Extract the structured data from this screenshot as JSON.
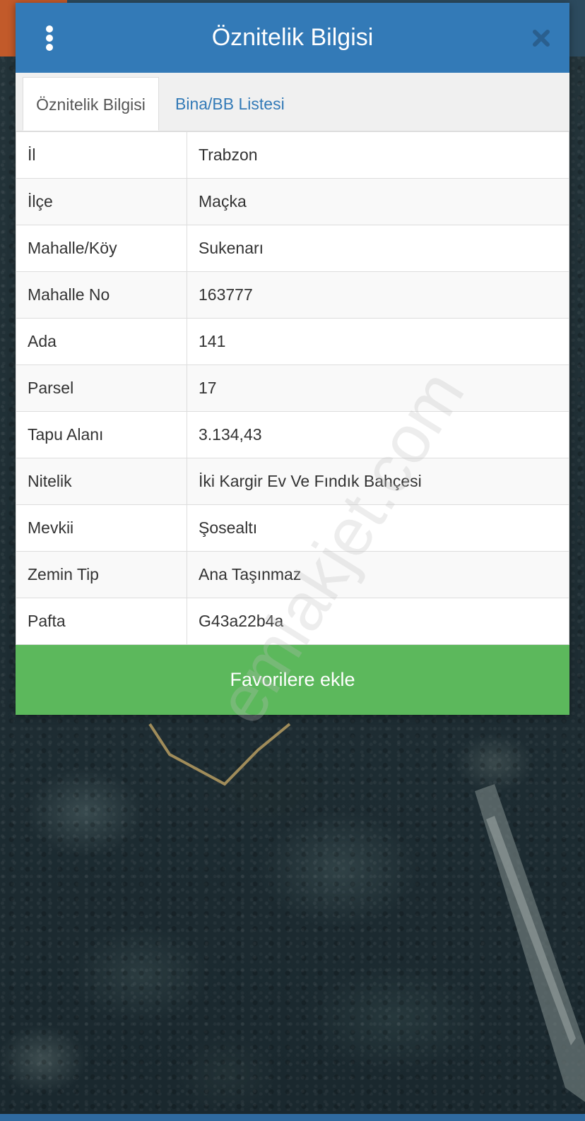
{
  "header": {
    "title": "Öznitelik Bilgisi"
  },
  "tabs": [
    {
      "label": "Öznitelik Bilgisi",
      "active": true
    },
    {
      "label": "Bina/BB Listesi",
      "active": false
    }
  ],
  "attributes": [
    {
      "key": "İl",
      "value": "Trabzon"
    },
    {
      "key": "İlçe",
      "value": "Maçka"
    },
    {
      "key": "Mahalle/Köy",
      "value": "Sukenarı"
    },
    {
      "key": "Mahalle No",
      "value": "163777"
    },
    {
      "key": "Ada",
      "value": "141"
    },
    {
      "key": "Parsel",
      "value": "17"
    },
    {
      "key": "Tapu Alanı",
      "value": "3.134,43"
    },
    {
      "key": "Nitelik",
      "value": "İki Kargir Ev Ve Fındık Bahçesi"
    },
    {
      "key": "Mevkii",
      "value": "Şosealtı"
    },
    {
      "key": "Zemin Tip",
      "value": "Ana Taşınmaz"
    },
    {
      "key": "Pafta",
      "value": "G43a22b4a"
    }
  ],
  "favorite_button": {
    "label": "Favorilere ekle"
  },
  "watermark": "emlakjet.com",
  "colors": {
    "header": "#337ab7",
    "button": "#5cb85c",
    "tab_link": "#337ab7",
    "parcel_outline": "#a08c5a"
  },
  "icons": {
    "menu": "vertical-dots-icon",
    "close": "close-x-icon"
  }
}
